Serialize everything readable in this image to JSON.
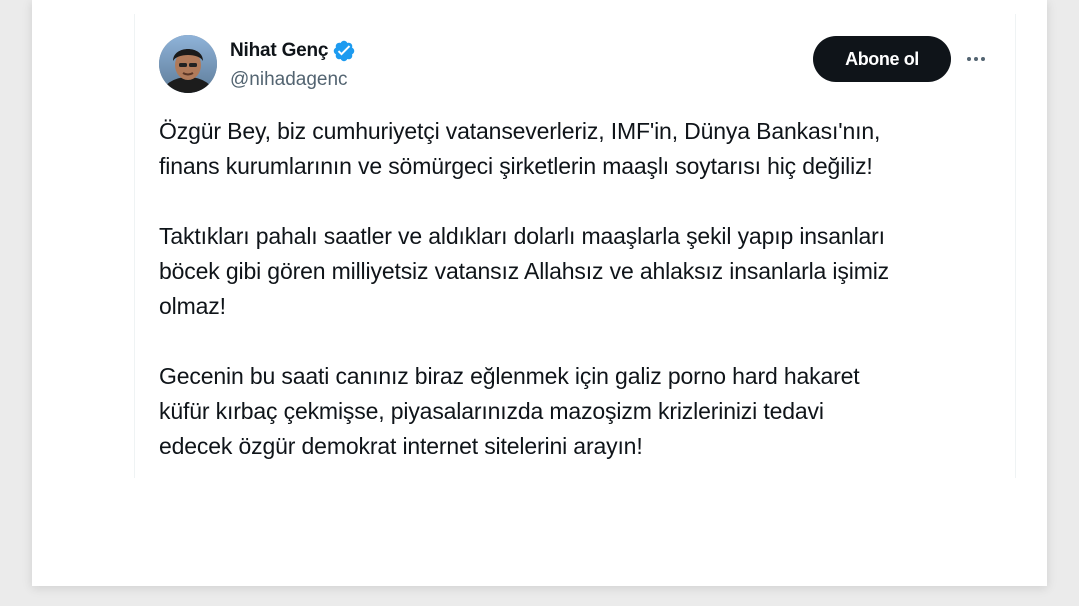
{
  "author": {
    "name": "Nihat Genç",
    "handle": "@nihadagenc",
    "verified": true,
    "verified_color": "#1d9bf0"
  },
  "follow_button": {
    "label": "Abone ol"
  },
  "more_button": {
    "icon": "more-horizontal-icon"
  },
  "tweet": {
    "paragraphs": [
      {
        "lines": [
          "Özgür Bey, biz cumhuriyetçi vatanseverleriz, IMF'in, Dünya Bankası'nın,",
          "finans kurumlarının ve sömürgeci şirketlerin maaşlı soytarısı hiç değiliz!"
        ]
      },
      {
        "lines": [
          "Taktıkları pahalı saatler ve aldıkları dolarlı maaşlarla şekil yapıp insanları",
          "böcek gibi gören milliyetsiz vatansız Allahsız ve ahlaksız insanlarla işimiz",
          "olmaz!"
        ]
      },
      {
        "lines": [
          "Gecenin bu saati canınız biraz eğlenmek için galiz porno hard hakaret",
          "küfür kırbaç çekmişse, piyasalarınızda mazoşizm krizlerinizi tedavi",
          "edecek özgür demokrat internet sitelerini arayın!"
        ]
      }
    ]
  },
  "colors": {
    "text_primary": "#0f1419",
    "text_secondary": "#536471",
    "button_bg": "#0f1419"
  }
}
